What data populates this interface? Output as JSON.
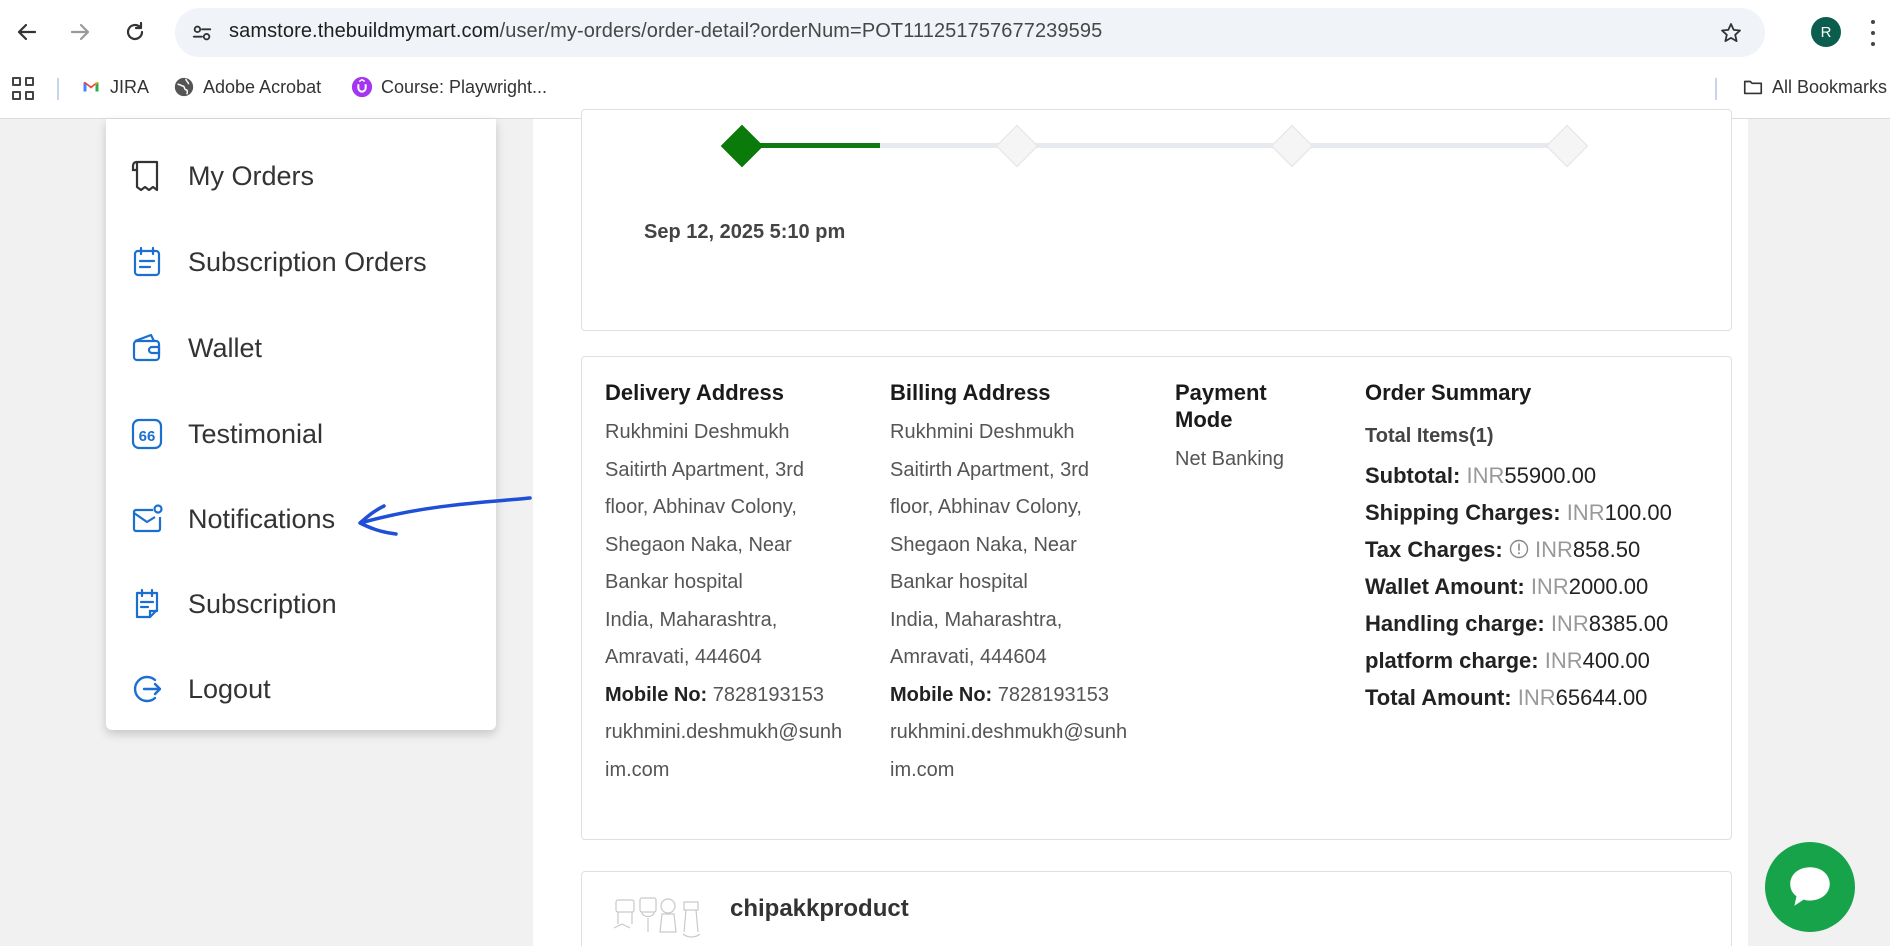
{
  "browser": {
    "url_host": "samstore.thebuildmymart.com",
    "url_path": "/user/my-orders/order-detail?orderNum=POT111251757677239595",
    "profile_initial": "R",
    "bookmarks": [
      {
        "label": "JIRA",
        "icon": "gmail-icon"
      },
      {
        "label": "Adobe Acrobat",
        "icon": "globe-icon"
      },
      {
        "label": "Course: Playwright...",
        "icon": "udemy-icon"
      }
    ],
    "all_bookmarks_label": "All Bookmarks"
  },
  "sidebar": {
    "items": [
      {
        "label": "My Orders",
        "icon": "receipt-icon"
      },
      {
        "label": "Subscription Orders",
        "icon": "calendar-list-icon"
      },
      {
        "label": "Wallet",
        "icon": "wallet-icon"
      },
      {
        "label": "Testimonial",
        "icon": "quote-icon"
      },
      {
        "label": "Notifications",
        "icon": "mail-notification-icon"
      },
      {
        "label": "Subscription",
        "icon": "subscription-doc-icon"
      },
      {
        "label": "Logout",
        "icon": "logout-icon"
      }
    ]
  },
  "tracker": {
    "date": "Sep 12, 2025 5:10 pm",
    "completed_steps": 1,
    "total_steps": 4
  },
  "order": {
    "delivery": {
      "title": "Delivery Address",
      "name": "Rukhmini Deshmukh",
      "line1": "Saitirth Apartment, 3rd",
      "line2": "floor, Abhinav Colony,",
      "line3": "Shegaon Naka, Near",
      "line4": "Bankar hospital",
      "line5": "India, Maharashtra,",
      "line6": "Amravati, 444604",
      "mobile_label": "Mobile No:",
      "mobile": "7828193153",
      "email1": "rukhmini.deshmukh@sunh",
      "email2": "im.com"
    },
    "billing": {
      "title": "Billing Address",
      "name": "Rukhmini Deshmukh",
      "line1": "Saitirth Apartment, 3rd",
      "line2": "floor, Abhinav Colony,",
      "line3": "Shegaon Naka, Near",
      "line4": "Bankar hospital",
      "line5": "India, Maharashtra,",
      "line6": "Amravati, 444604",
      "mobile_label": "Mobile No:",
      "mobile": "7828193153",
      "email1": "rukhmini.deshmukh@sunh",
      "email2": "im.com"
    },
    "payment": {
      "title_line1": "Payment",
      "title_line2": "Mode",
      "value": "Net Banking"
    },
    "summary": {
      "title": "Order Summary",
      "total_items": "Total Items(1)",
      "currency": "INR",
      "subtotal_label": "Subtotal:",
      "subtotal": "55900.00",
      "shipping_label": "Shipping Charges:",
      "shipping": "100.00",
      "tax_label": "Tax Charges:",
      "tax": "858.50",
      "wallet_label": "Wallet Amount:",
      "wallet": "2000.00",
      "handling_label": "Handling charge:",
      "handling": "8385.00",
      "platform_label": "platform charge:",
      "platform": "400.00",
      "total_label": "Total Amount:",
      "total": "65644.00"
    }
  },
  "product": {
    "name": "chipakkproduct"
  },
  "colors": {
    "accent_green": "#0a7a0a",
    "chat_green": "#17a34a",
    "icon_blue": "#1a6fd1",
    "annotation_blue": "#1f4fd6"
  }
}
